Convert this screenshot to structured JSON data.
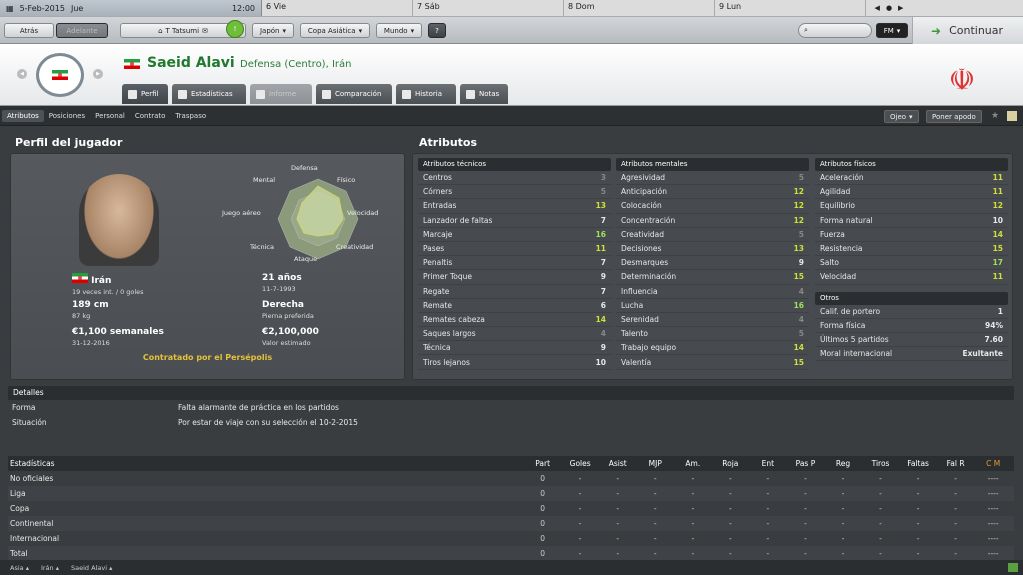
{
  "calendar": {
    "current_date": "5-Feb-2015",
    "current_day": "Jue",
    "time": "12:00",
    "days": [
      "6 Vie",
      "7 Sáb",
      "8 Dom",
      "9 Lun"
    ]
  },
  "toolbar": {
    "back": "Atrás",
    "forward": "Adelante",
    "manager": "T Tatsumi",
    "buttons": [
      "Japón",
      "Copa Asiática",
      "Mundo"
    ],
    "help": "?",
    "fm": "FM",
    "continue": "Continuar"
  },
  "player": {
    "name": "Saeid Alavi",
    "description": "Defensa (Centro), Irán"
  },
  "tabs": [
    "Perfil",
    "Estadísticas",
    "Informe",
    "Comparación",
    "Historia",
    "Notas"
  ],
  "subtabs": [
    "Atributos",
    "Posiciones",
    "Personal",
    "Contrato",
    "Traspaso"
  ],
  "subtab_right": {
    "eye": "Ojeo",
    "nickname": "Poner apodo"
  },
  "profile": {
    "title": "Perfil del jugador",
    "radar_labels": [
      "Defensa",
      "Físico",
      "Velocidad",
      "Creatividad",
      "Ataque",
      "Técnica",
      "Juego aéreo",
      "Mental"
    ],
    "nationality": "Irán",
    "caps": "19 veces int. / 0 goles",
    "age": "21 años",
    "dob": "11-7-1993",
    "height": "189 cm",
    "weight": "87 kg",
    "foot": "Derecha",
    "foot_label": "Pierna preferida",
    "wage": "€1,100 semanales",
    "contract_end": "31-12-2016",
    "value": "€2,100,000",
    "value_label": "Valor estimado",
    "contract": "Contratado por el Persépolis"
  },
  "attributes": {
    "title": "Atributos",
    "technical": {
      "title": "Atributos técnicos",
      "rows": [
        [
          "Centros",
          "3"
        ],
        [
          "Córners",
          "5"
        ],
        [
          "Entradas",
          "13"
        ],
        [
          "Lanzador de faltas",
          "7"
        ],
        [
          "Marcaje",
          "16"
        ],
        [
          "Pases",
          "11"
        ],
        [
          "Penaltis",
          "7"
        ],
        [
          "Primer Toque",
          "9"
        ],
        [
          "Regate",
          "7"
        ],
        [
          "Remate",
          "6"
        ],
        [
          "Remates cabeza",
          "14"
        ],
        [
          "Saques largos",
          "4"
        ],
        [
          "Técnica",
          "9"
        ],
        [
          "Tiros lejanos",
          "10"
        ]
      ]
    },
    "mental": {
      "title": "Atributos mentales",
      "rows": [
        [
          "Agresividad",
          "5"
        ],
        [
          "Anticipación",
          "12"
        ],
        [
          "Colocación",
          "12"
        ],
        [
          "Concentración",
          "12"
        ],
        [
          "Creatividad",
          "5"
        ],
        [
          "Decisiones",
          "13"
        ],
        [
          "Desmarques",
          "9"
        ],
        [
          "Determinación",
          "15"
        ],
        [
          "Influencia",
          "4"
        ],
        [
          "Lucha",
          "16"
        ],
        [
          "Serenidad",
          "4"
        ],
        [
          "Talento",
          "5"
        ],
        [
          "Trabajo equipo",
          "14"
        ],
        [
          "Valentía",
          "15"
        ]
      ]
    },
    "physical": {
      "title": "Atributos físicos",
      "rows": [
        [
          "Aceleración",
          "11"
        ],
        [
          "Agilidad",
          "11"
        ],
        [
          "Equilibrio",
          "12"
        ],
        [
          "Forma natural",
          "10"
        ],
        [
          "Fuerza",
          "14"
        ],
        [
          "Resistencia",
          "15"
        ],
        [
          "Salto",
          "17"
        ],
        [
          "Velocidad",
          "11"
        ]
      ]
    },
    "other": {
      "title": "Otros",
      "rows": [
        [
          "Calif. de portero",
          "1"
        ],
        [
          "Forma física",
          "94%"
        ],
        [
          "Últimos 5 partidos",
          "7.60"
        ],
        [
          "Moral internacional",
          "Exultante"
        ]
      ]
    }
  },
  "details": {
    "title": "Detalles",
    "rows": [
      [
        "Forma",
        "Falta alarmante de práctica en los partidos"
      ],
      [
        "Situación",
        "Por estar de viaje con su selección el 10-2-2015"
      ]
    ]
  },
  "stats": {
    "headers": [
      "Estadísticas",
      "Part",
      "Goles",
      "Asist",
      "MJP",
      "Am.",
      "Roja",
      "Ent",
      "Pas P",
      "Reg",
      "Tiros",
      "Faltas",
      "Fal R",
      "C M"
    ],
    "rows": [
      [
        "No oficiales",
        "0",
        "-",
        "-",
        "-",
        "-",
        "-",
        "-",
        "-",
        "-",
        "-",
        "-",
        "-",
        "----"
      ],
      [
        "Liga",
        "0",
        "-",
        "-",
        "-",
        "-",
        "-",
        "-",
        "-",
        "-",
        "-",
        "-",
        "-",
        "----"
      ],
      [
        "Copa",
        "0",
        "-",
        "-",
        "-",
        "-",
        "-",
        "-",
        "-",
        "-",
        "-",
        "-",
        "-",
        "----"
      ],
      [
        "Continental",
        "0",
        "-",
        "-",
        "-",
        "-",
        "-",
        "-",
        "-",
        "-",
        "-",
        "-",
        "-",
        "----"
      ],
      [
        "Internacional",
        "0",
        "-",
        "-",
        "-",
        "-",
        "-",
        "-",
        "-",
        "-",
        "-",
        "-",
        "-",
        "----"
      ],
      [
        "Total",
        "0",
        "-",
        "-",
        "-",
        "-",
        "-",
        "-",
        "-",
        "-",
        "-",
        "-",
        "-",
        "----"
      ]
    ]
  },
  "footer": [
    "Asia",
    "Irán",
    "Saeid Alavi"
  ],
  "colors": {
    "accent_green": "#1f7a2e",
    "highlight": "#cfe03a",
    "contract": "#e3c33a"
  }
}
